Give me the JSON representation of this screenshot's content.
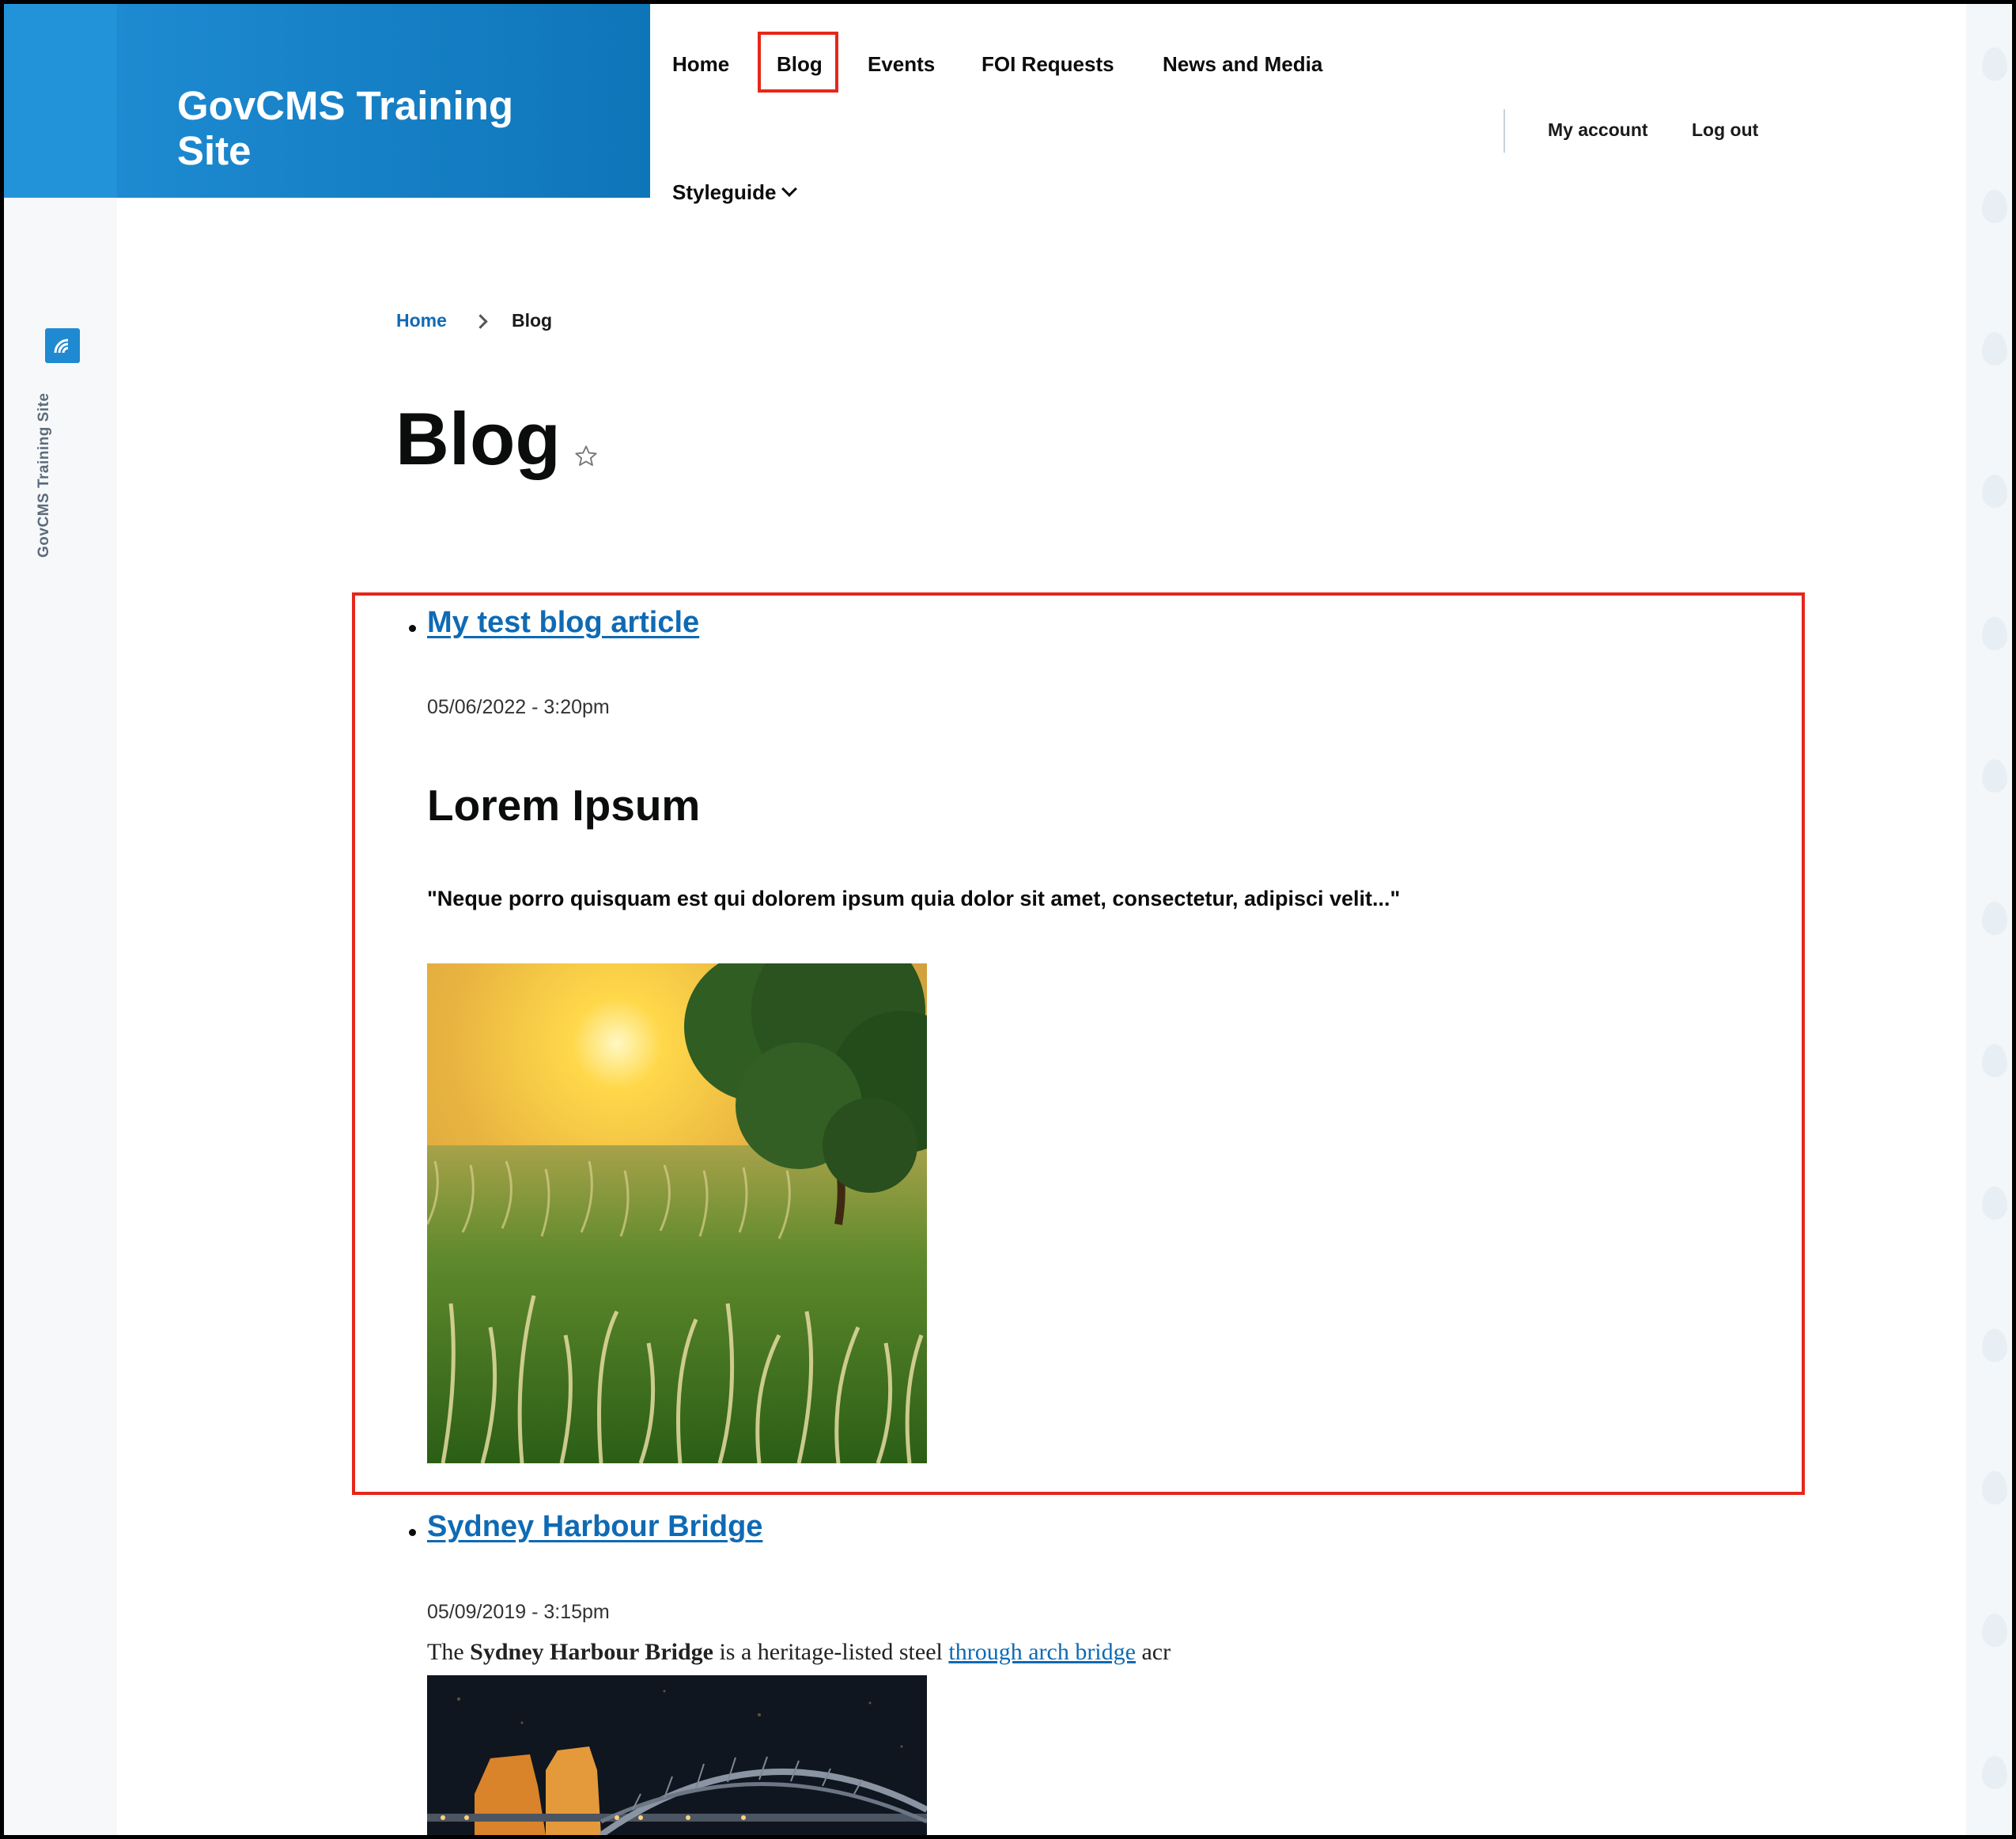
{
  "site": {
    "name": "GovCMS Training Site"
  },
  "toolbar": {
    "site_label": "GovCMS Training Site"
  },
  "nav": {
    "items": [
      "Home",
      "Blog",
      "Events",
      "FOI Requests",
      "News and Media"
    ],
    "styleguide": "Styleguide",
    "active": "Blog"
  },
  "user_menu": {
    "account": "My account",
    "logout": "Log out"
  },
  "breadcrumb": {
    "home": "Home",
    "current": "Blog"
  },
  "page": {
    "title": "Blog"
  },
  "articles": [
    {
      "title": "My test blog article",
      "date": "05/06/2022 - 3:20pm",
      "heading": "Lorem Ipsum",
      "quote": "\"Neque porro quisquam est qui dolorem ipsum quia dolor sit amet, consectetur, adipisci velit...\""
    },
    {
      "title": "Sydney Harbour Bridge",
      "date": "05/09/2019 - 3:15pm",
      "body_prefix": "The ",
      "body_bold": "Sydney Harbour Bridge",
      "body_mid": " is a heritage-listed steel ",
      "body_link": "through arch bridge",
      "body_suffix": " acr"
    }
  ],
  "colors": {
    "brand": "#1d8ad1",
    "link": "#0f6ab4",
    "highlight": "#e5271a"
  }
}
